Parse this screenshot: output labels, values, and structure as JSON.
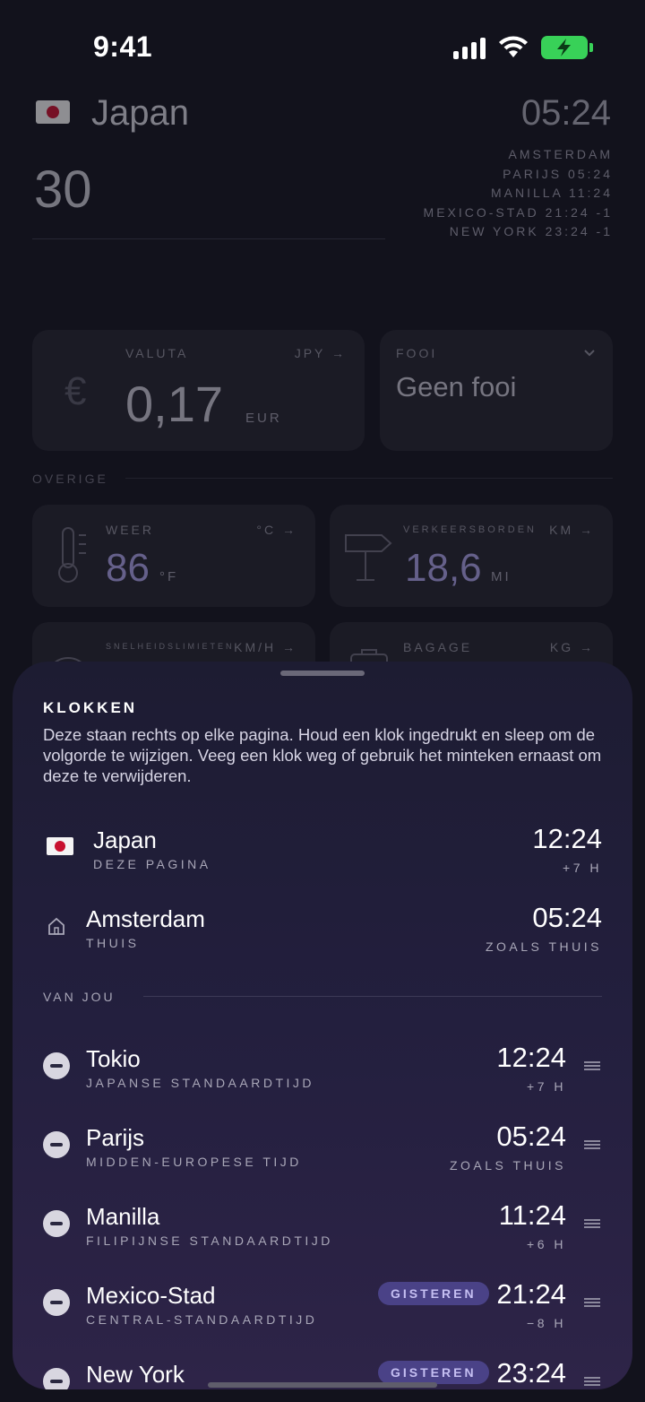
{
  "status": {
    "time": "9:41"
  },
  "background": {
    "country": "Japan",
    "amount": "30",
    "big_clock": "05:24",
    "clocks": [
      {
        "label": "AMSTERDAM"
      },
      {
        "label": "PARIJS 05:24"
      },
      {
        "label": "MANILLA 11:24"
      },
      {
        "label": "MEXICO-STAD 21:24 -1"
      },
      {
        "label": "NEW YORK 23:24 -1"
      }
    ],
    "valuta": {
      "label": "VALUTA",
      "unit": "JPY →",
      "value": "0,17",
      "suffix": "EUR"
    },
    "fooi": {
      "label": "FOOI",
      "value": "Geen fooi"
    },
    "section_label": "OVERIGE",
    "weer": {
      "label": "WEER",
      "unit": "°C →",
      "value": "86",
      "suffix": "°F"
    },
    "verkeersborden": {
      "label": "VERKEERSBORDEN",
      "unit": "KM →",
      "value": "18,6",
      "suffix": "MI"
    },
    "snelheid": {
      "label": "SNELHEIDSLIMIETEN",
      "unit": "KM/H →"
    },
    "bagage": {
      "label": "BAGAGE",
      "unit": "KG →"
    }
  },
  "sheet": {
    "title": "KLOKKEN",
    "description": "Deze staan rechts op elke pagina. Houd een klok ingedrukt en sleep om de volgorde te wijzigen. Veeg een klok weg of gebruik het minteken ernaast om deze te verwijderen.",
    "page_clock": {
      "city": "Japan",
      "sub": "DEZE PAGINA",
      "time": "12:24",
      "offset": "+7 H"
    },
    "home_clock": {
      "city": "Amsterdam",
      "sub": "THUIS",
      "time": "05:24",
      "offset": "ZOALS THUIS"
    },
    "section_label": "VAN JOU",
    "clocks": [
      {
        "city": "Tokio",
        "sub": "JAPANSE STANDAARDTIJD",
        "time": "12:24",
        "offset": "+7 H",
        "badge": ""
      },
      {
        "city": "Parijs",
        "sub": "MIDDEN-EUROPESE TIJD",
        "time": "05:24",
        "offset": "ZOALS THUIS",
        "badge": ""
      },
      {
        "city": "Manilla",
        "sub": "FILIPIJNSE STANDAARDTIJD",
        "time": "11:24",
        "offset": "+6 H",
        "badge": ""
      },
      {
        "city": "Mexico-Stad",
        "sub": "CENTRAL-STANDAARDTIJD",
        "time": "21:24",
        "offset": "−8 H",
        "badge": "GISTEREN"
      },
      {
        "city": "New York",
        "sub": "",
        "time": "23:24",
        "offset": "",
        "badge": "GISTEREN"
      }
    ]
  },
  "colors": {
    "accent": "#a9a0e6",
    "badge_bg": "#4a4287",
    "battery": "#38d158"
  }
}
